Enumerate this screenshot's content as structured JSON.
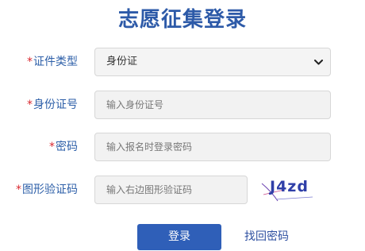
{
  "title": {
    "text": "志愿征集登录",
    "color": "#2d5aa8"
  },
  "form": {
    "required_mark": "*",
    "id_type": {
      "label": "证件类型",
      "selected": "身份证"
    },
    "id_number": {
      "label": "身份证号",
      "placeholder": "输入身份证号"
    },
    "password": {
      "label": "密码",
      "placeholder": "输入报名时登录密码"
    },
    "captcha": {
      "label": "图形验证码",
      "placeholder": "输入右边图形验证码",
      "image_text": "J4zd"
    }
  },
  "actions": {
    "login_label": "登录",
    "forgot_label": "找回密码"
  },
  "colors": {
    "label": "#2d5fa8",
    "required": "#d9282f",
    "button": "#2f5fb8",
    "field_bg": "#f2f2f2"
  }
}
